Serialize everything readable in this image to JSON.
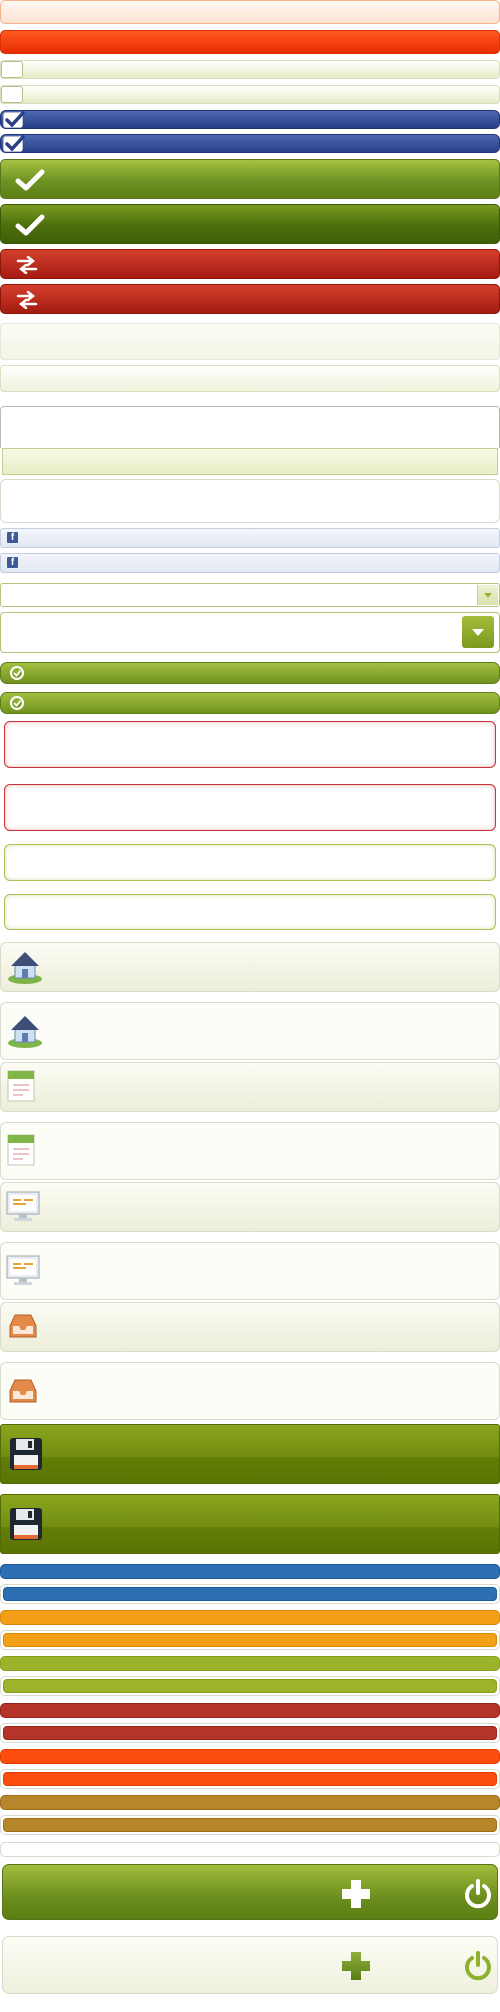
{
  "controls": {
    "rows": [
      {
        "name": "orange-light-bar"
      },
      {
        "name": "red-button-bar"
      },
      {
        "name": "checkbox-unchecked-1"
      },
      {
        "name": "checkbox-unchecked-2"
      },
      {
        "name": "checkbox-checked-1"
      },
      {
        "name": "checkbox-checked-2"
      }
    ]
  },
  "icons": {
    "check": "check-icon",
    "swap": "swap-arrows-icon",
    "facebook": "facebook-icon",
    "dropdown": "chevron-down-icon",
    "house": "house-icon",
    "calendar": "calendar-icon",
    "monitor": "monitor-icon",
    "inbox": "inbox-tray-icon",
    "save": "floppy-disk-icon",
    "plus": "plus-icon",
    "power": "power-icon"
  },
  "facebook": {
    "letter": "f"
  },
  "colors": {
    "accent_green": "#6e9222",
    "accent_red": "#e82c00",
    "accent_blue": "#273f86",
    "thin_bars": [
      "#2d6fb3",
      "#f3a018",
      "#9cb42c",
      "#b5342a",
      "#fc4c0e",
      "#b8862a",
      "#ffffff"
    ]
  }
}
